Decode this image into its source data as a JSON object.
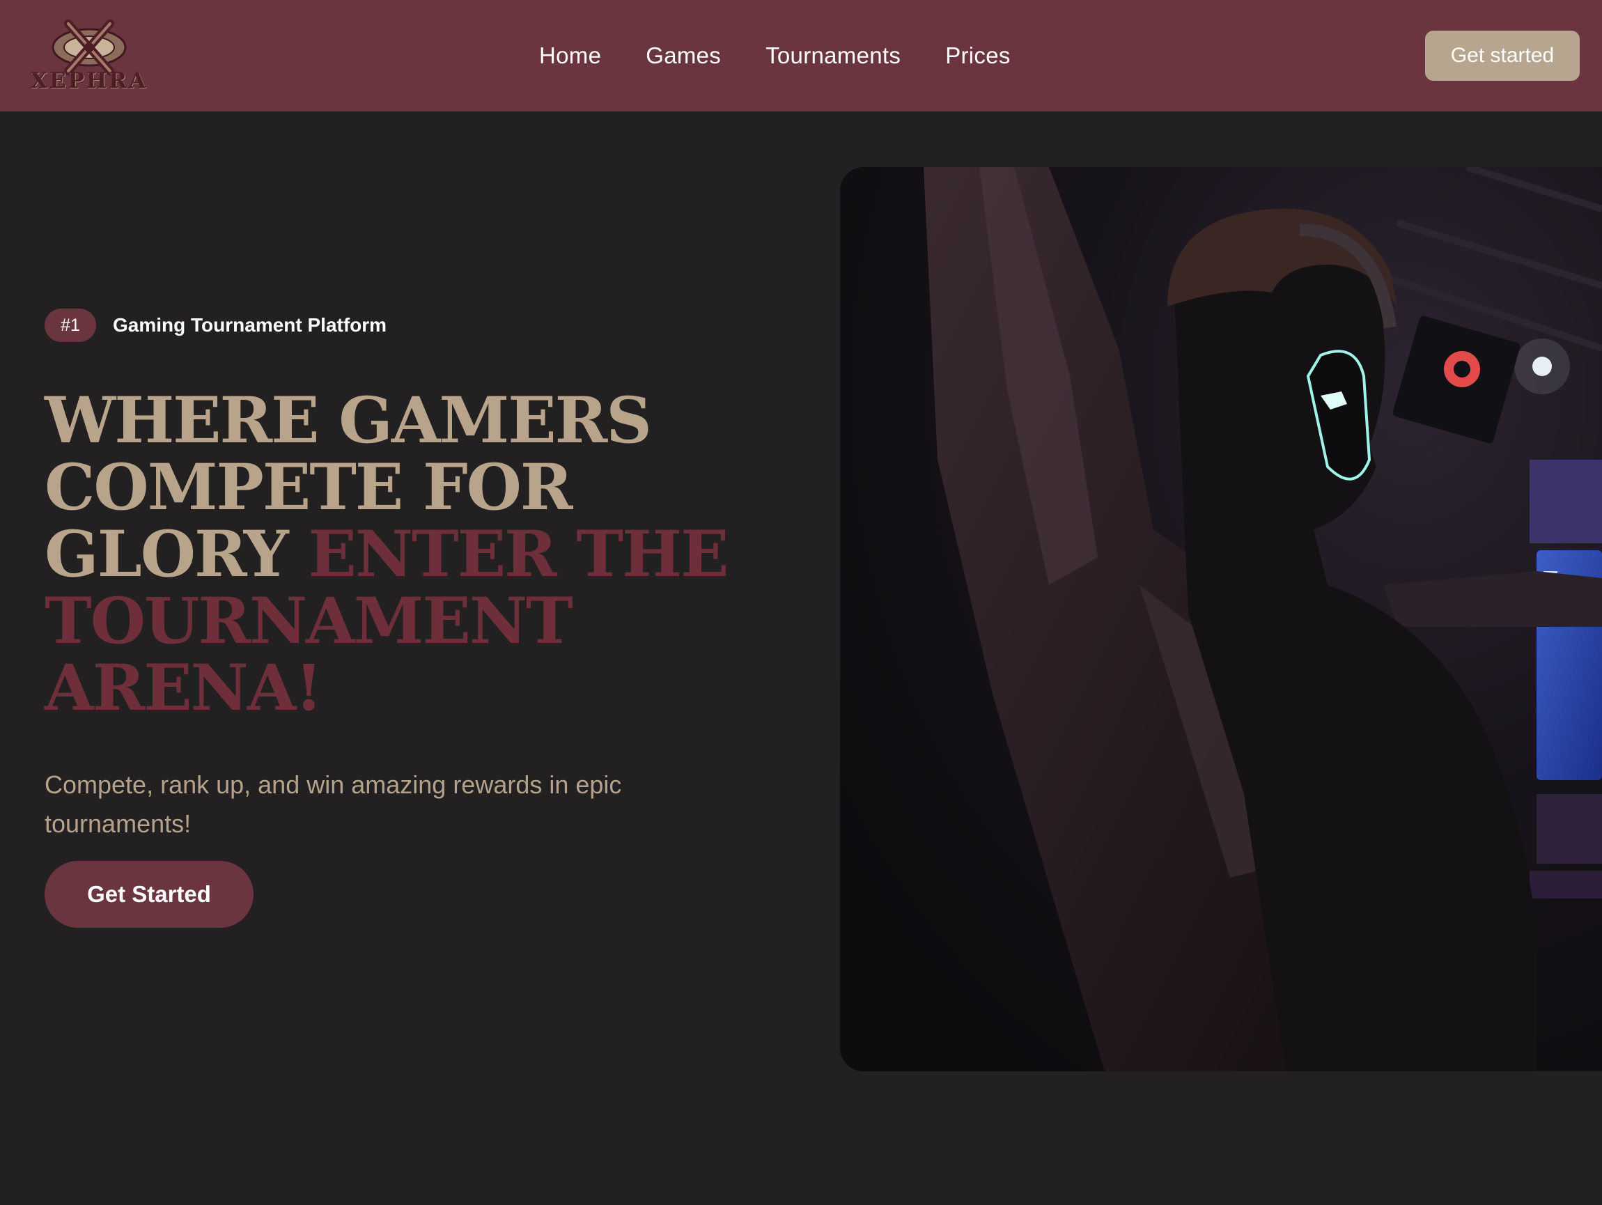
{
  "brand": {
    "name": "XEPHRA",
    "logo_icon": "crossed-swords-emblem"
  },
  "nav": {
    "items": [
      {
        "label": "Home"
      },
      {
        "label": "Games"
      },
      {
        "label": "Tournaments"
      },
      {
        "label": "Prices"
      }
    ],
    "cta_label": "Get started"
  },
  "hero": {
    "badge": "#1",
    "badge_label": "Gaming Tournament Platform",
    "headline_main": "WHERE GAMERS COMPETE FOR GLORY",
    "headline_accent": "ENTER THE TOURNAMENT ARENA!",
    "subtext": "Compete, rank up, and win amazing rewards in epic tournaments!",
    "cta_label": "Get Started",
    "image_alt": "Gamer wearing headset sitting in gaming chair at esports arena"
  },
  "colors": {
    "header_bg": "#6b3540",
    "page_bg": "#222021",
    "beige": "#b8a48b",
    "accent": "#6e2f3b"
  }
}
